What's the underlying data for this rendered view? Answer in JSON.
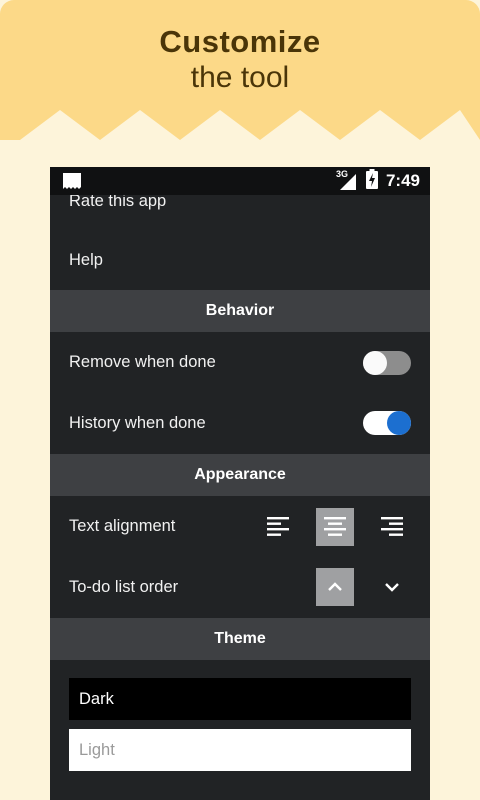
{
  "promo": {
    "line1": "Customize",
    "line2": "the tool",
    "banner_color": "#fcd988",
    "background_color": "#fdf4da"
  },
  "status_bar": {
    "network": "3G",
    "time": "7:49",
    "left_icon": "notification-icon",
    "signal_icon": "signal-icon",
    "battery_icon": "battery-charging-icon"
  },
  "settings": {
    "rate_label": "Rate this app",
    "help_label": "Help",
    "behavior_header": "Behavior",
    "remove_when_done": {
      "label": "Remove when done",
      "enabled": false
    },
    "history_when_done": {
      "label": "History when done",
      "enabled": true
    },
    "appearance_header": "Appearance",
    "text_alignment": {
      "label": "Text alignment",
      "options": [
        "left",
        "center",
        "right"
      ],
      "selected": "center"
    },
    "todo_order": {
      "label": "To-do list order",
      "options": [
        "ascending",
        "descending"
      ],
      "selected": "ascending"
    },
    "theme_header": "Theme",
    "theme_options": [
      "Dark",
      "Light"
    ],
    "selected_theme": "Dark"
  },
  "colors": {
    "surface": "#212325",
    "section_header": "#3e4043",
    "accent": "#1c6fd0"
  }
}
